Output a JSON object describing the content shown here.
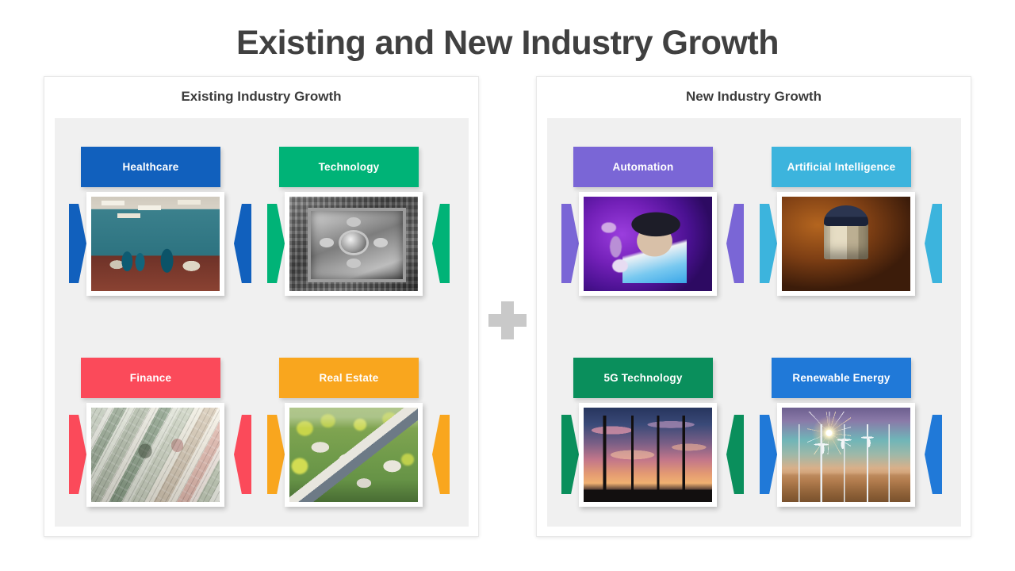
{
  "title": "Existing and New Industry Growth",
  "divider": {
    "icon": "plus-icon",
    "color": "#c9c9c9"
  },
  "panels": [
    {
      "id": "existing",
      "title": "Existing Industry Growth",
      "items": [
        {
          "label": "Healthcare",
          "color": "#1160bd",
          "photo": "hospital-ward-photo",
          "art": "ph-hospital"
        },
        {
          "label": "Technology",
          "color": "#00b377",
          "photo": "microchip-photo",
          "art": "ph-chip"
        },
        {
          "label": "Finance",
          "color": "#fb4a5a",
          "photo": "dollar-bills-photo",
          "art": "ph-money"
        },
        {
          "label": "Real Estate",
          "color": "#f9a61e",
          "photo": "suburban-homes-photo",
          "art": "ph-suburb"
        }
      ]
    },
    {
      "id": "new",
      "title": "New Industry Growth",
      "items": [
        {
          "label": "Automation",
          "color": "#7a66d6",
          "photo": "vr-headset-photo",
          "art": "ph-vr"
        },
        {
          "label": "Artificial Intelligence",
          "color": "#3cb4dd",
          "photo": "robot-droid-photo",
          "art": "ph-droid"
        },
        {
          "label": "5G Technology",
          "color": "#0a8f5c",
          "photo": "cell-towers-photo",
          "art": "ph-towers"
        },
        {
          "label": "Renewable Energy",
          "color": "#2079d8",
          "photo": "wind-turbines-photo",
          "art": "ph-wind"
        }
      ]
    }
  ]
}
